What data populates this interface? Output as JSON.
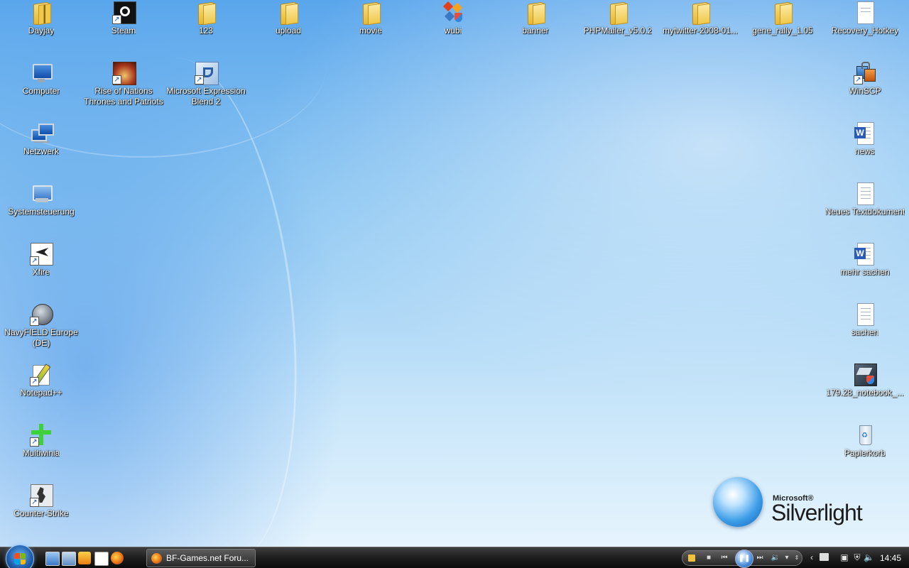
{
  "desktop_icons": [
    {
      "label": "Dayjay"
    },
    {
      "label": "Steam"
    },
    {
      "label": "123"
    },
    {
      "label": "upload"
    },
    {
      "label": "movie"
    },
    {
      "label": "wubi"
    },
    {
      "label": "banner"
    },
    {
      "label": "PHPMailer_v5.0.2"
    },
    {
      "label": "mytwitter-2008-01..."
    },
    {
      "label": "gene_rally_1.05"
    },
    {
      "label": "Recovery_Hotkey"
    },
    {
      "label": "Computer"
    },
    {
      "label": "Rise of Nations Thrones and Patriots"
    },
    {
      "label": "Microsoft Expression Blend 2"
    },
    {
      "label": "WinSCP"
    },
    {
      "label": "Netzwerk"
    },
    {
      "label": "news"
    },
    {
      "label": "Systemsteuerung"
    },
    {
      "label": "Neues Textdokument"
    },
    {
      "label": "Xfire"
    },
    {
      "label": "mehr sachen"
    },
    {
      "label": "NavyFIELD Europe (DE)"
    },
    {
      "label": "sachen"
    },
    {
      "label": "Notepad++"
    },
    {
      "label": "179.28_notebook_..."
    },
    {
      "label": "Multiwinia"
    },
    {
      "label": "Papierkorb"
    },
    {
      "label": "Counter-Strike"
    }
  ],
  "branding": {
    "microsoft": "Microsoft®",
    "product": "Silverlight"
  },
  "taskbar": {
    "start_icon": "windows-orb",
    "quick_launch": [
      "show-desktop-icon",
      "switch-windows-icon",
      "media-player-icon",
      "xfire-icon",
      "firefox-icon"
    ],
    "open_window": "BF-Games.net Foru...",
    "clock": "14:45"
  }
}
